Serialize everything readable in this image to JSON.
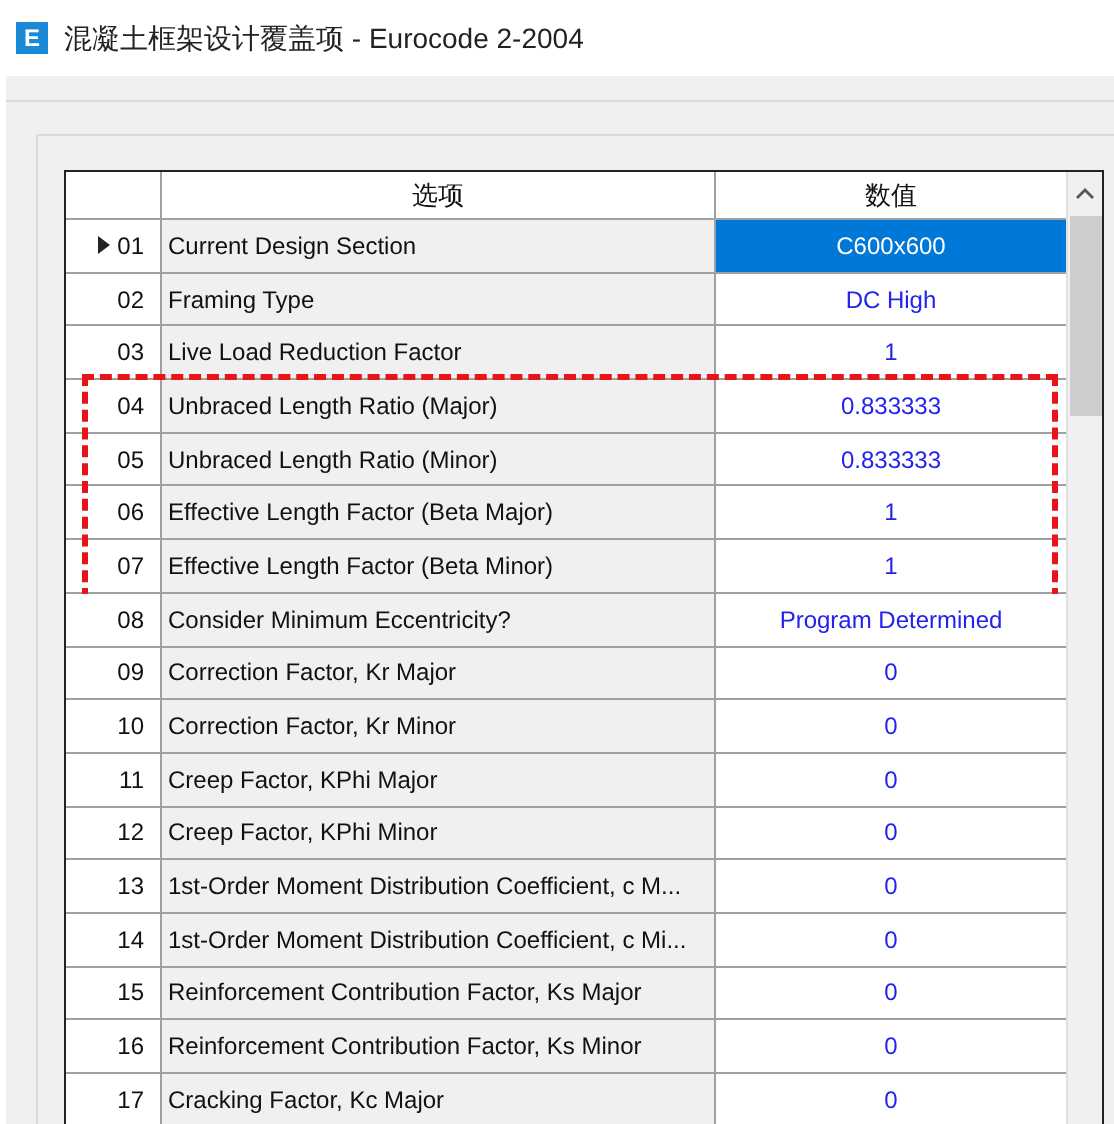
{
  "window": {
    "icon_letter": "E",
    "title": "混凝土框架设计覆盖项 - Eurocode 2-2004"
  },
  "table": {
    "columns": [
      "选项",
      "数值"
    ],
    "rows": [
      {
        "number": "01",
        "option": "Current Design Section",
        "value": "C600x600",
        "selected": true,
        "highlighted": false
      },
      {
        "number": "02",
        "option": "Framing Type",
        "value": "DC High",
        "selected": false,
        "highlighted": false
      },
      {
        "number": "03",
        "option": "Live Load Reduction Factor",
        "value": "1",
        "selected": false,
        "highlighted": false
      },
      {
        "number": "04",
        "option": "Unbraced Length Ratio (Major)",
        "value": "0.833333",
        "selected": false,
        "highlighted": true
      },
      {
        "number": "05",
        "option": "Unbraced Length Ratio (Minor)",
        "value": "0.833333",
        "selected": false,
        "highlighted": true
      },
      {
        "number": "06",
        "option": "Effective Length Factor (Beta Major)",
        "value": "1",
        "selected": false,
        "highlighted": true
      },
      {
        "number": "07",
        "option": "Effective Length Factor (Beta Minor)",
        "value": "1",
        "selected": false,
        "highlighted": true
      },
      {
        "number": "08",
        "option": "Consider Minimum Eccentricity?",
        "value": "Program Determined",
        "selected": false,
        "highlighted": false
      },
      {
        "number": "09",
        "option": "Correction Factor, Kr Major",
        "value": "0",
        "selected": false,
        "highlighted": false
      },
      {
        "number": "10",
        "option": "Correction Factor, Kr Minor",
        "value": "0",
        "selected": false,
        "highlighted": false
      },
      {
        "number": "11",
        "option": "Creep Factor, KPhi Major",
        "value": "0",
        "selected": false,
        "highlighted": false
      },
      {
        "number": "12",
        "option": "Creep Factor, KPhi Minor",
        "value": "0",
        "selected": false,
        "highlighted": false
      },
      {
        "number": "13",
        "option": "1st-Order Moment Distribution Coefficient, c M...",
        "value": "0",
        "selected": false,
        "highlighted": false
      },
      {
        "number": "14",
        "option": "1st-Order Moment Distribution Coefficient, c Mi...",
        "value": "0",
        "selected": false,
        "highlighted": false
      },
      {
        "number": "15",
        "option": "Reinforcement Contribution Factor, Ks Major",
        "value": "0",
        "selected": false,
        "highlighted": false
      },
      {
        "number": "16",
        "option": "Reinforcement Contribution Factor, Ks Minor",
        "value": "0",
        "selected": false,
        "highlighted": false
      },
      {
        "number": "17",
        "option": "Cracking Factor, Kc Major",
        "value": "0",
        "selected": false,
        "highlighted": false
      }
    ]
  }
}
